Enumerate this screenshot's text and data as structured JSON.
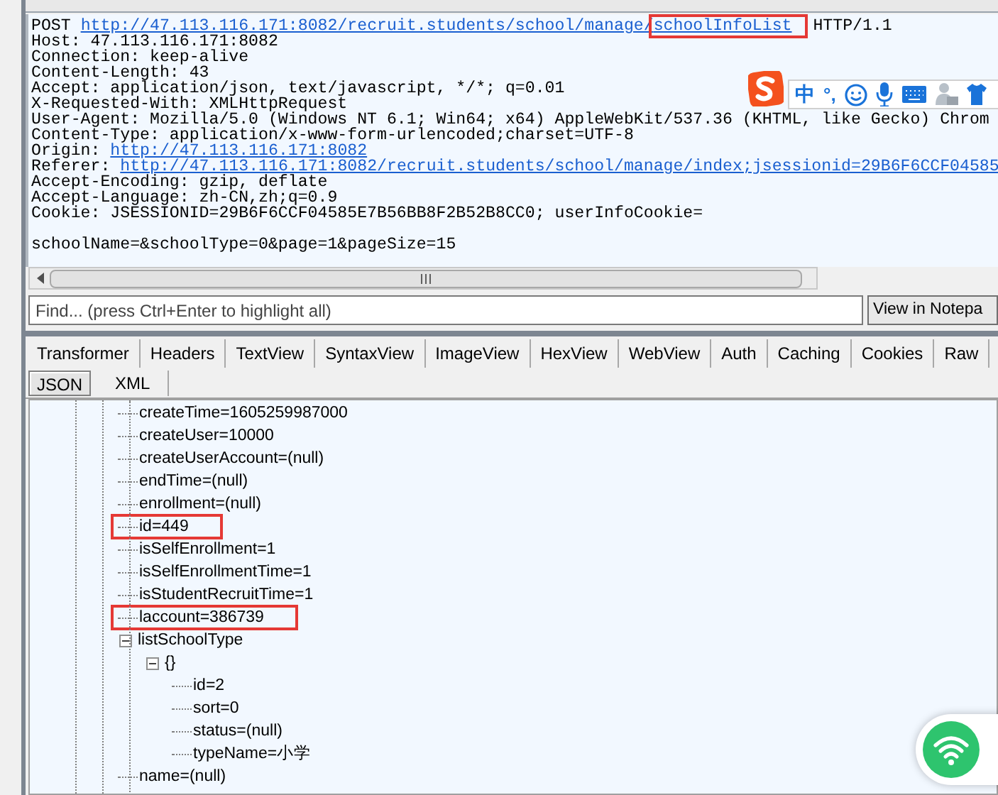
{
  "request": {
    "lines": [
      {
        "kind": "request_line",
        "method": "POST",
        "url_base": "http://47.113.116.171:8082/recruit.students/school/manage/",
        "url_end": "schoolInfoList",
        "url_end_highlighted": true,
        "version": "HTTP/1.1"
      },
      {
        "kind": "text",
        "text": "Host: 47.113.116.171:8082"
      },
      {
        "kind": "text",
        "text": "Connection: keep-alive"
      },
      {
        "kind": "text",
        "text": "Content-Length: 43"
      },
      {
        "kind": "text",
        "text": "Accept: application/json, text/javascript, */*; q=0.01"
      },
      {
        "kind": "text",
        "text": "X-Requested-With: XMLHttpRequest"
      },
      {
        "kind": "text",
        "text": "User-Agent: Mozilla/5.0 (Windows NT 6.1; Win64; x64) AppleWebKit/537.36 (KHTML, like Gecko) Chrom"
      },
      {
        "kind": "text",
        "text": "Content-Type: application/x-www-form-urlencoded;charset=UTF-8"
      },
      {
        "kind": "link",
        "name": "Origin:",
        "url": "http://47.113.116.171:8082"
      },
      {
        "kind": "link",
        "name": "Referer:",
        "url": "http://47.113.116.171:8082/recruit.students/school/manage/index;jsessionid=29B6F6CCF04585"
      },
      {
        "kind": "text",
        "text": "Accept-Encoding: gzip, deflate"
      },
      {
        "kind": "text",
        "text": "Accept-Language: zh-CN,zh;q=0.9"
      },
      {
        "kind": "text",
        "text": "Cookie: JSESSIONID=29B6F6CCF04585E7B56BB8F2B52B8CC0; userInfoCookie="
      },
      {
        "kind": "blank"
      },
      {
        "kind": "text",
        "text": "schoolName=&schoolType=0&page=1&pageSize=15"
      }
    ]
  },
  "find": {
    "placeholder": "Find... (press Ctrl+Enter to highlight all)",
    "button": "View in Notepa"
  },
  "tabs": [
    {
      "label": "Transformer",
      "selected": false
    },
    {
      "label": "Headers",
      "selected": false
    },
    {
      "label": "TextView",
      "selected": false
    },
    {
      "label": "SyntaxView",
      "selected": false
    },
    {
      "label": "ImageView",
      "selected": false
    },
    {
      "label": "HexView",
      "selected": false
    },
    {
      "label": "WebView",
      "selected": false
    },
    {
      "label": "Auth",
      "selected": false
    },
    {
      "label": "Caching",
      "selected": false
    },
    {
      "label": "Cookies",
      "selected": false
    },
    {
      "label": "Raw",
      "selected": false
    }
  ],
  "subtabs": [
    {
      "label": "JSON",
      "selected": true
    },
    {
      "label": "XML",
      "selected": false
    }
  ],
  "tree": [
    {
      "label": "createTime=1605259987000",
      "highlighted": false
    },
    {
      "label": "createUser=10000",
      "highlighted": false
    },
    {
      "label": "createUserAccount=(null)",
      "highlighted": false
    },
    {
      "label": "endTime=(null)",
      "highlighted": false
    },
    {
      "label": "enrollment=(null)",
      "highlighted": false
    },
    {
      "label": "id=449",
      "highlighted": true
    },
    {
      "label": "isSelfEnrollment=1",
      "highlighted": false
    },
    {
      "label": "isSelfEnrollmentTime=1",
      "highlighted": false
    },
    {
      "label": "isStudentRecruitTime=1",
      "highlighted": false
    },
    {
      "label": "laccount=386739",
      "highlighted": true
    },
    {
      "label": "listSchoolType",
      "highlighted": false,
      "expanded": true,
      "children": [
        {
          "label": "{}",
          "highlighted": false,
          "expanded": true,
          "children": [
            {
              "label": "id=2",
              "highlighted": false
            },
            {
              "label": "sort=0",
              "highlighted": false
            },
            {
              "label": "status=(null)",
              "highlighted": false
            },
            {
              "label": "typeName=小学",
              "highlighted": false
            }
          ]
        }
      ]
    },
    {
      "label": "name=(null)",
      "highlighted": false
    }
  ],
  "ime_toolbar": {
    "mode": "中",
    "punctuation": "°,"
  }
}
